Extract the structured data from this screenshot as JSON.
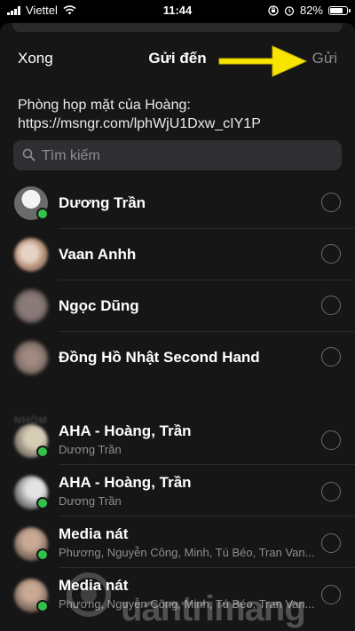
{
  "status_bar": {
    "carrier": "Viettel",
    "time": "11:44",
    "battery_text": "82%",
    "battery_level": 0.82,
    "icons": [
      "signal-icon",
      "wifi-icon",
      "orientation-lock-icon",
      "alarm-icon",
      "battery-icon"
    ]
  },
  "nav": {
    "done_label": "Xong",
    "title": "Gửi đến",
    "send_label": "Gửi",
    "send_color": "#8b8b8b",
    "annotation_arrow_color": "#f7e400"
  },
  "share_link": {
    "text": "Phòng họp mặt của Hoàng: https://msngr.com/lphWjU1Dxw_cIY1P"
  },
  "search": {
    "placeholder": "Tìm kiếm",
    "value": ""
  },
  "section_header": "NHÓM",
  "contacts": [
    {
      "name": "Dương Trần",
      "online": true
    },
    {
      "name": "Vaan Anhh",
      "online": false
    },
    {
      "name": "Ngọc Dũng",
      "online": false
    },
    {
      "name": "Đồng Hồ Nhật Second Hand",
      "online": false
    }
  ],
  "groups": [
    {
      "name": "AHA - Hoàng, Trần",
      "members": "Dương Trần",
      "online": true
    },
    {
      "name": "AHA - Hoàng, Trần",
      "members": "Dương Trần",
      "online": true
    },
    {
      "name": "Media nát",
      "members": "Phương, Nguyễn Công, Minh, Tú Béo, Tran Van...",
      "online": true
    },
    {
      "name": "Media nát",
      "members": "Phương, Nguyễn Công, Minh, Tú Béo, Tran Van...",
      "online": true
    }
  ],
  "watermark": "uantrimang",
  "colors": {
    "background": "#000000",
    "sheet": "#161616",
    "search_field": "#2f2f31",
    "online": "#31c24b"
  }
}
